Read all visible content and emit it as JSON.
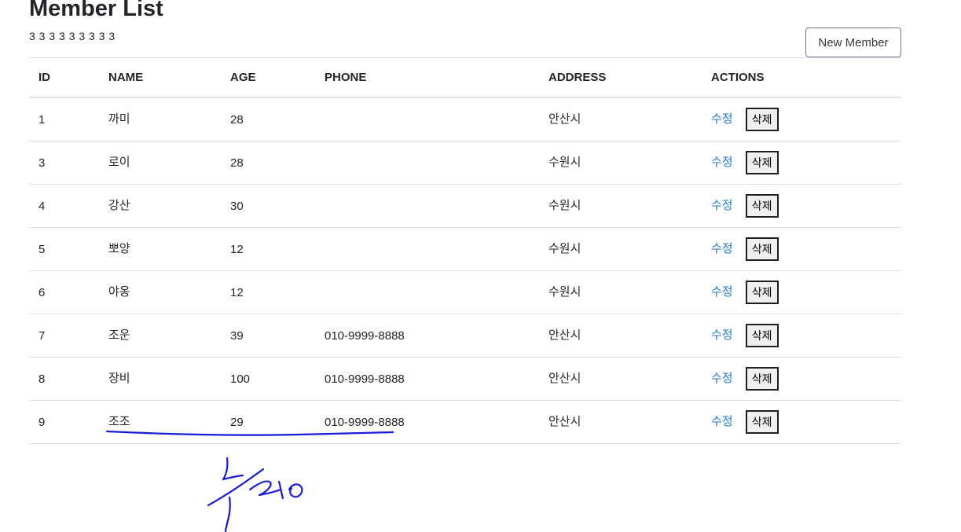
{
  "page": {
    "title": "Member List",
    "subtitle": "3 3 3 3 3 3 3 3 3",
    "new_member_label": "New Member"
  },
  "table": {
    "headers": [
      "ID",
      "NAME",
      "AGE",
      "PHONE",
      "ADDRESS",
      "ACTIONS"
    ],
    "edit_label": "수정",
    "delete_label": "삭제",
    "rows": [
      {
        "id": "1",
        "name": "까미",
        "age": "28",
        "phone": "",
        "address": "안산시"
      },
      {
        "id": "3",
        "name": "로이",
        "age": "28",
        "phone": "",
        "address": "수원시"
      },
      {
        "id": "4",
        "name": "강산",
        "age": "30",
        "phone": "",
        "address": "수원시"
      },
      {
        "id": "5",
        "name": "뽀양",
        "age": "12",
        "phone": "",
        "address": "수원시"
      },
      {
        "id": "6",
        "name": "야옹",
        "age": "12",
        "phone": "",
        "address": "수원시"
      },
      {
        "id": "7",
        "name": "조운",
        "age": "39",
        "phone": "010-9999-8888",
        "address": "안산시"
      },
      {
        "id": "8",
        "name": "장비",
        "age": "100",
        "phone": "010-9999-8888",
        "address": "안산시"
      },
      {
        "id": "9",
        "name": "조조",
        "age": "29",
        "phone": "010-9999-8888",
        "address": "안산시"
      }
    ]
  },
  "annotation": {
    "ink_color": "#1a1adb"
  }
}
